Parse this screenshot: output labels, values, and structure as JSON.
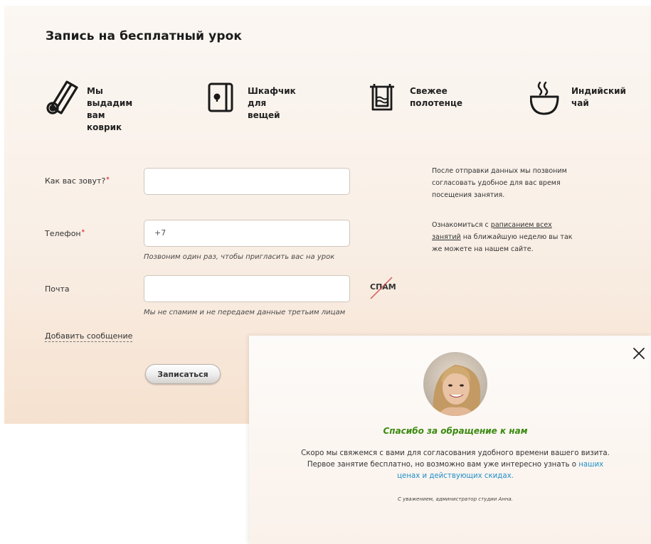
{
  "form": {
    "title": "Запись на бесплатный урок",
    "features": [
      {
        "icon": "yoga-mat-icon",
        "line1": "Мы выдадим",
        "line2": "вам коврик"
      },
      {
        "icon": "locker-icon",
        "line1": "Шкафчик",
        "line2": "для вещей"
      },
      {
        "icon": "towel-icon",
        "line1": "Свежее",
        "line2": "полотенце"
      },
      {
        "icon": "tea-cup-icon",
        "line1": "Индийский",
        "line2": "чай"
      }
    ],
    "name_label": "Как вас зовут?",
    "required_mark": "*",
    "name_value": "",
    "phone_label": "Телефон",
    "phone_value": "+7",
    "phone_hint": "Позвоним один раз, чтобы пригласить вас на урок",
    "email_label": "Почта",
    "email_value": "",
    "email_hint": "Мы не спамим и не передаем данные третьим лицам",
    "spam_badge": "СПАМ",
    "add_message": "Добавить сообщение",
    "submit": "Записаться"
  },
  "side_info": {
    "p1": "После отправки данных мы позвоним согласовать удобное для вас время посещения занятия.",
    "p2_before": "Ознакомиться с ",
    "p2_link": "раписанием всех занятий",
    "p2_after": " на ближайшую неделю вы так же можете на нашем сайте."
  },
  "modal": {
    "close_icon": "close-icon",
    "avatar": "admin-avatar",
    "thanks": "Спасибо за обращение к нам",
    "message_before": "Скоро мы свяжемся с вами для согласования удобного времени вашего визита. Первое занятие бесплатно, но возможно вам уже интересно узнать о ",
    "message_link": "наших ценах и действующих скидах.",
    "signature": "С уважением, администратор студии Анна."
  },
  "colors": {
    "thanks_green": "#3a8a10",
    "link_blue": "#1f8fc8",
    "required_red": "#d60000"
  }
}
